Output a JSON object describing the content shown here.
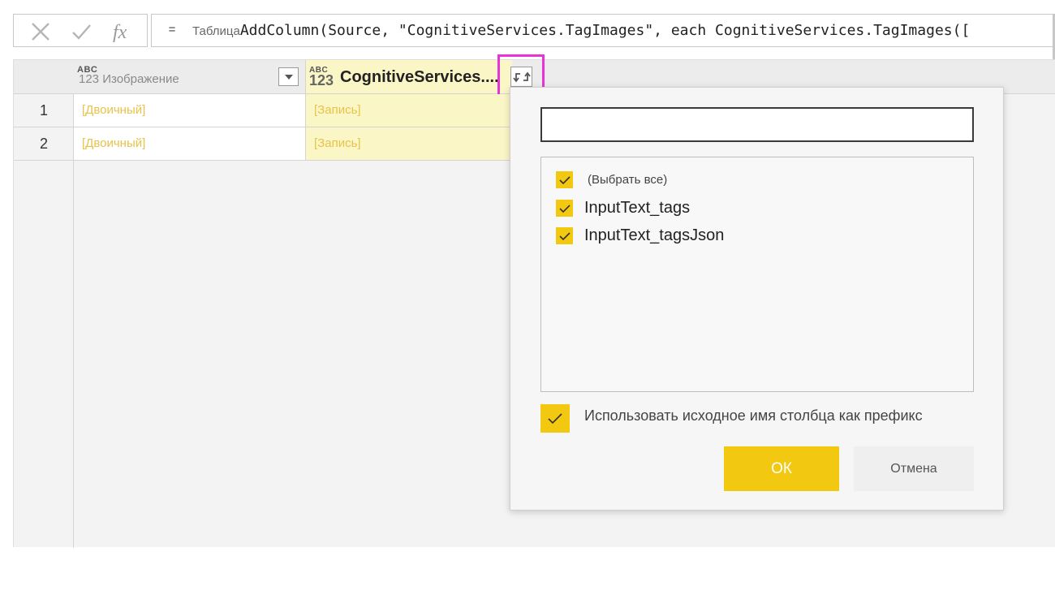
{
  "formula_bar": {
    "equals": "=",
    "prefix": "Таблица",
    "formula": "AddColumn(Source, \"CognitiveServices.TagImages\", each CognitiveServices.TagImages(["
  },
  "grid": {
    "columns": [
      {
        "type_top": "ABC",
        "type_bottom": "123",
        "name": "Изображение"
      },
      {
        "type_top": "ABC",
        "type_bottom": "123",
        "name": "CognitiveServices...."
      }
    ],
    "rows": [
      {
        "num": "1",
        "c1": "[Двоичный]",
        "c2": "[Запись]"
      },
      {
        "num": "2",
        "c1": "[Двоичный]",
        "c2": "[Запись]"
      }
    ]
  },
  "expand_popup": {
    "search_value": "",
    "items": [
      {
        "label": "(Выбрать все)",
        "checked": true
      },
      {
        "label": "InputText_tags",
        "checked": true
      },
      {
        "label": "InputText_tagsJson",
        "checked": true
      }
    ],
    "use_prefix_label": "Использовать исходное имя столбца как префикс",
    "use_prefix_checked": true,
    "ok_label": "ОК",
    "cancel_label": "Отмена"
  },
  "colors": {
    "accent": "#f2c811",
    "highlight": "#e834d6",
    "selected_column": "#fbf6c6",
    "cell_text": "#e8c24a"
  }
}
